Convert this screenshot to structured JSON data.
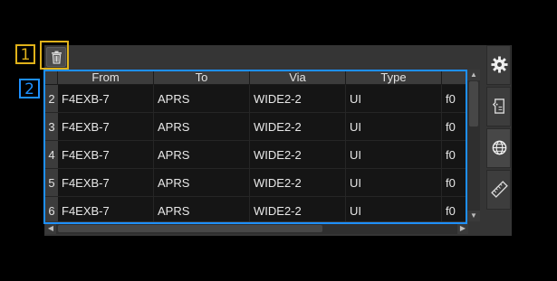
{
  "callouts": {
    "one": "1",
    "two": "2"
  },
  "toolbar": {
    "icon": "trash-icon"
  },
  "table": {
    "headers": [
      "From",
      "To",
      "Via",
      "Type",
      ""
    ],
    "rows": [
      {
        "num": "2",
        "from": "F4EXB-7",
        "to": "APRS",
        "via": "WIDE2-2",
        "type": "UI",
        "extra": "f0"
      },
      {
        "num": "3",
        "from": "F4EXB-7",
        "to": "APRS",
        "via": "WIDE2-2",
        "type": "UI",
        "extra": "f0"
      },
      {
        "num": "4",
        "from": "F4EXB-7",
        "to": "APRS",
        "via": "WIDE2-2",
        "type": "UI",
        "extra": "f0"
      },
      {
        "num": "5",
        "from": "F4EXB-7",
        "to": "APRS",
        "via": "WIDE2-2",
        "type": "UI",
        "extra": "f0"
      },
      {
        "num": "6",
        "from": "F4EXB-7",
        "to": "APRS",
        "via": "WIDE2-2",
        "type": "UI",
        "extra": "f0"
      }
    ]
  },
  "rail": {
    "icons": [
      "gear-icon",
      "tag-icon",
      "globe-icon",
      "ruler-icon"
    ]
  },
  "colors": {
    "callout_yellow": "#e0b21a",
    "callout_blue": "#1e90ff",
    "panel_bg": "#353535",
    "cell_bg": "#151515"
  }
}
